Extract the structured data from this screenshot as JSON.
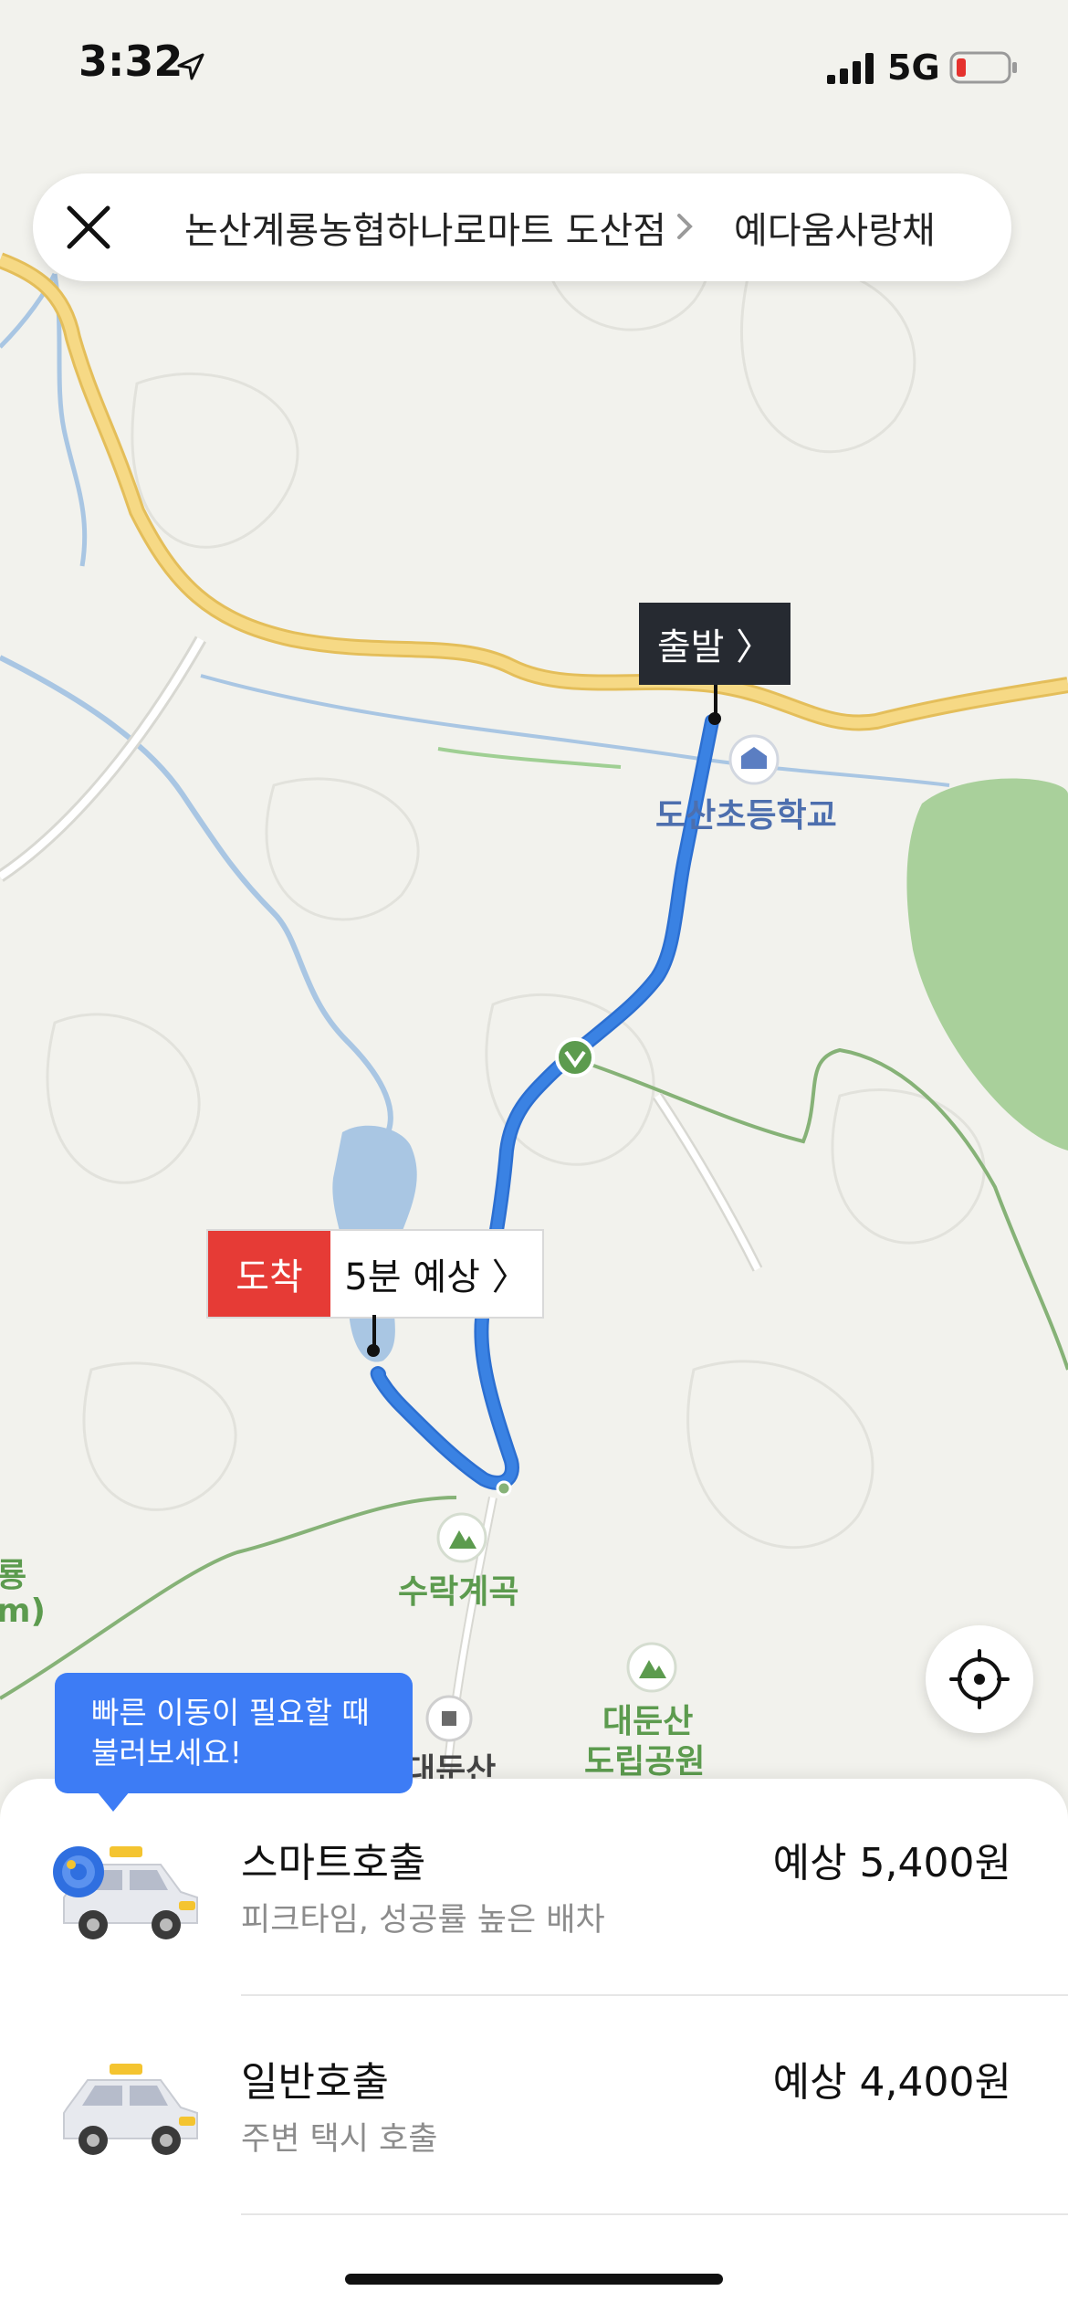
{
  "status_bar": {
    "time": "3:32",
    "network": "5G",
    "battery_color": "#e5322e"
  },
  "route": {
    "from": "논산계룡농협하나로마트 도산점",
    "to": "예다움사랑채"
  },
  "map": {
    "start_label": "출발 〉",
    "arrive_label": "도착",
    "eta_label": "5분 예상 〉",
    "pois": {
      "school": "도산초등학교",
      "valley": "수락계곡",
      "park_line1": "대둔산",
      "park_line2": "도립공원",
      "stop": "대둔산",
      "edge_text_1": "룡",
      "edge_text_2": "m)"
    },
    "route_color": "#3a82e3",
    "road_color": "#f3d27a"
  },
  "tooltip": {
    "line1": "빠른 이동이 필요할 때",
    "line2": "불러보세요!"
  },
  "options": [
    {
      "title": "스마트호출",
      "subtitle": "피크타임, 성공률 높은 배차",
      "price": "예상 5,400원",
      "icon": "smart-taxi-icon"
    },
    {
      "title": "일반호출",
      "subtitle": "주변 택시 호출",
      "price": "예상 4,400원",
      "icon": "taxi-icon"
    }
  ]
}
